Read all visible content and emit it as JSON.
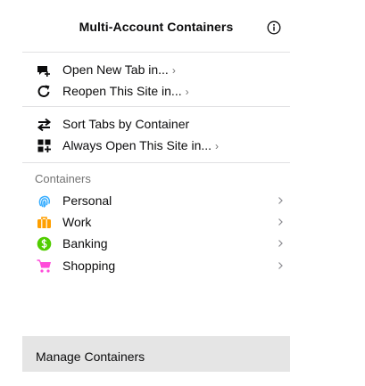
{
  "header": {
    "title": "Multi-Account Containers",
    "info_icon": "info-icon"
  },
  "actions": {
    "items": [
      {
        "label": "Open New Tab in...",
        "chevron": "›",
        "icon": "new-tab-icon"
      },
      {
        "label": "Reopen This Site in...",
        "chevron": "›",
        "icon": "reopen-icon"
      }
    ]
  },
  "tools": {
    "items": [
      {
        "label": "Sort Tabs by Container",
        "icon": "sort-icon"
      },
      {
        "label": "Always Open This Site in...",
        "chevron": "›",
        "icon": "always-open-icon"
      }
    ]
  },
  "containers": {
    "heading": "Containers",
    "items": [
      {
        "label": "Personal",
        "icon": "fingerprint-icon",
        "color": "#37adff"
      },
      {
        "label": "Work",
        "icon": "briefcase-icon",
        "color": "#ff9f00"
      },
      {
        "label": "Banking",
        "icon": "dollar-icon",
        "color": "#51cd00"
      },
      {
        "label": "Shopping",
        "icon": "cart-icon",
        "color": "#ff4bda"
      }
    ]
  },
  "footer": {
    "label": "Manage Containers"
  }
}
